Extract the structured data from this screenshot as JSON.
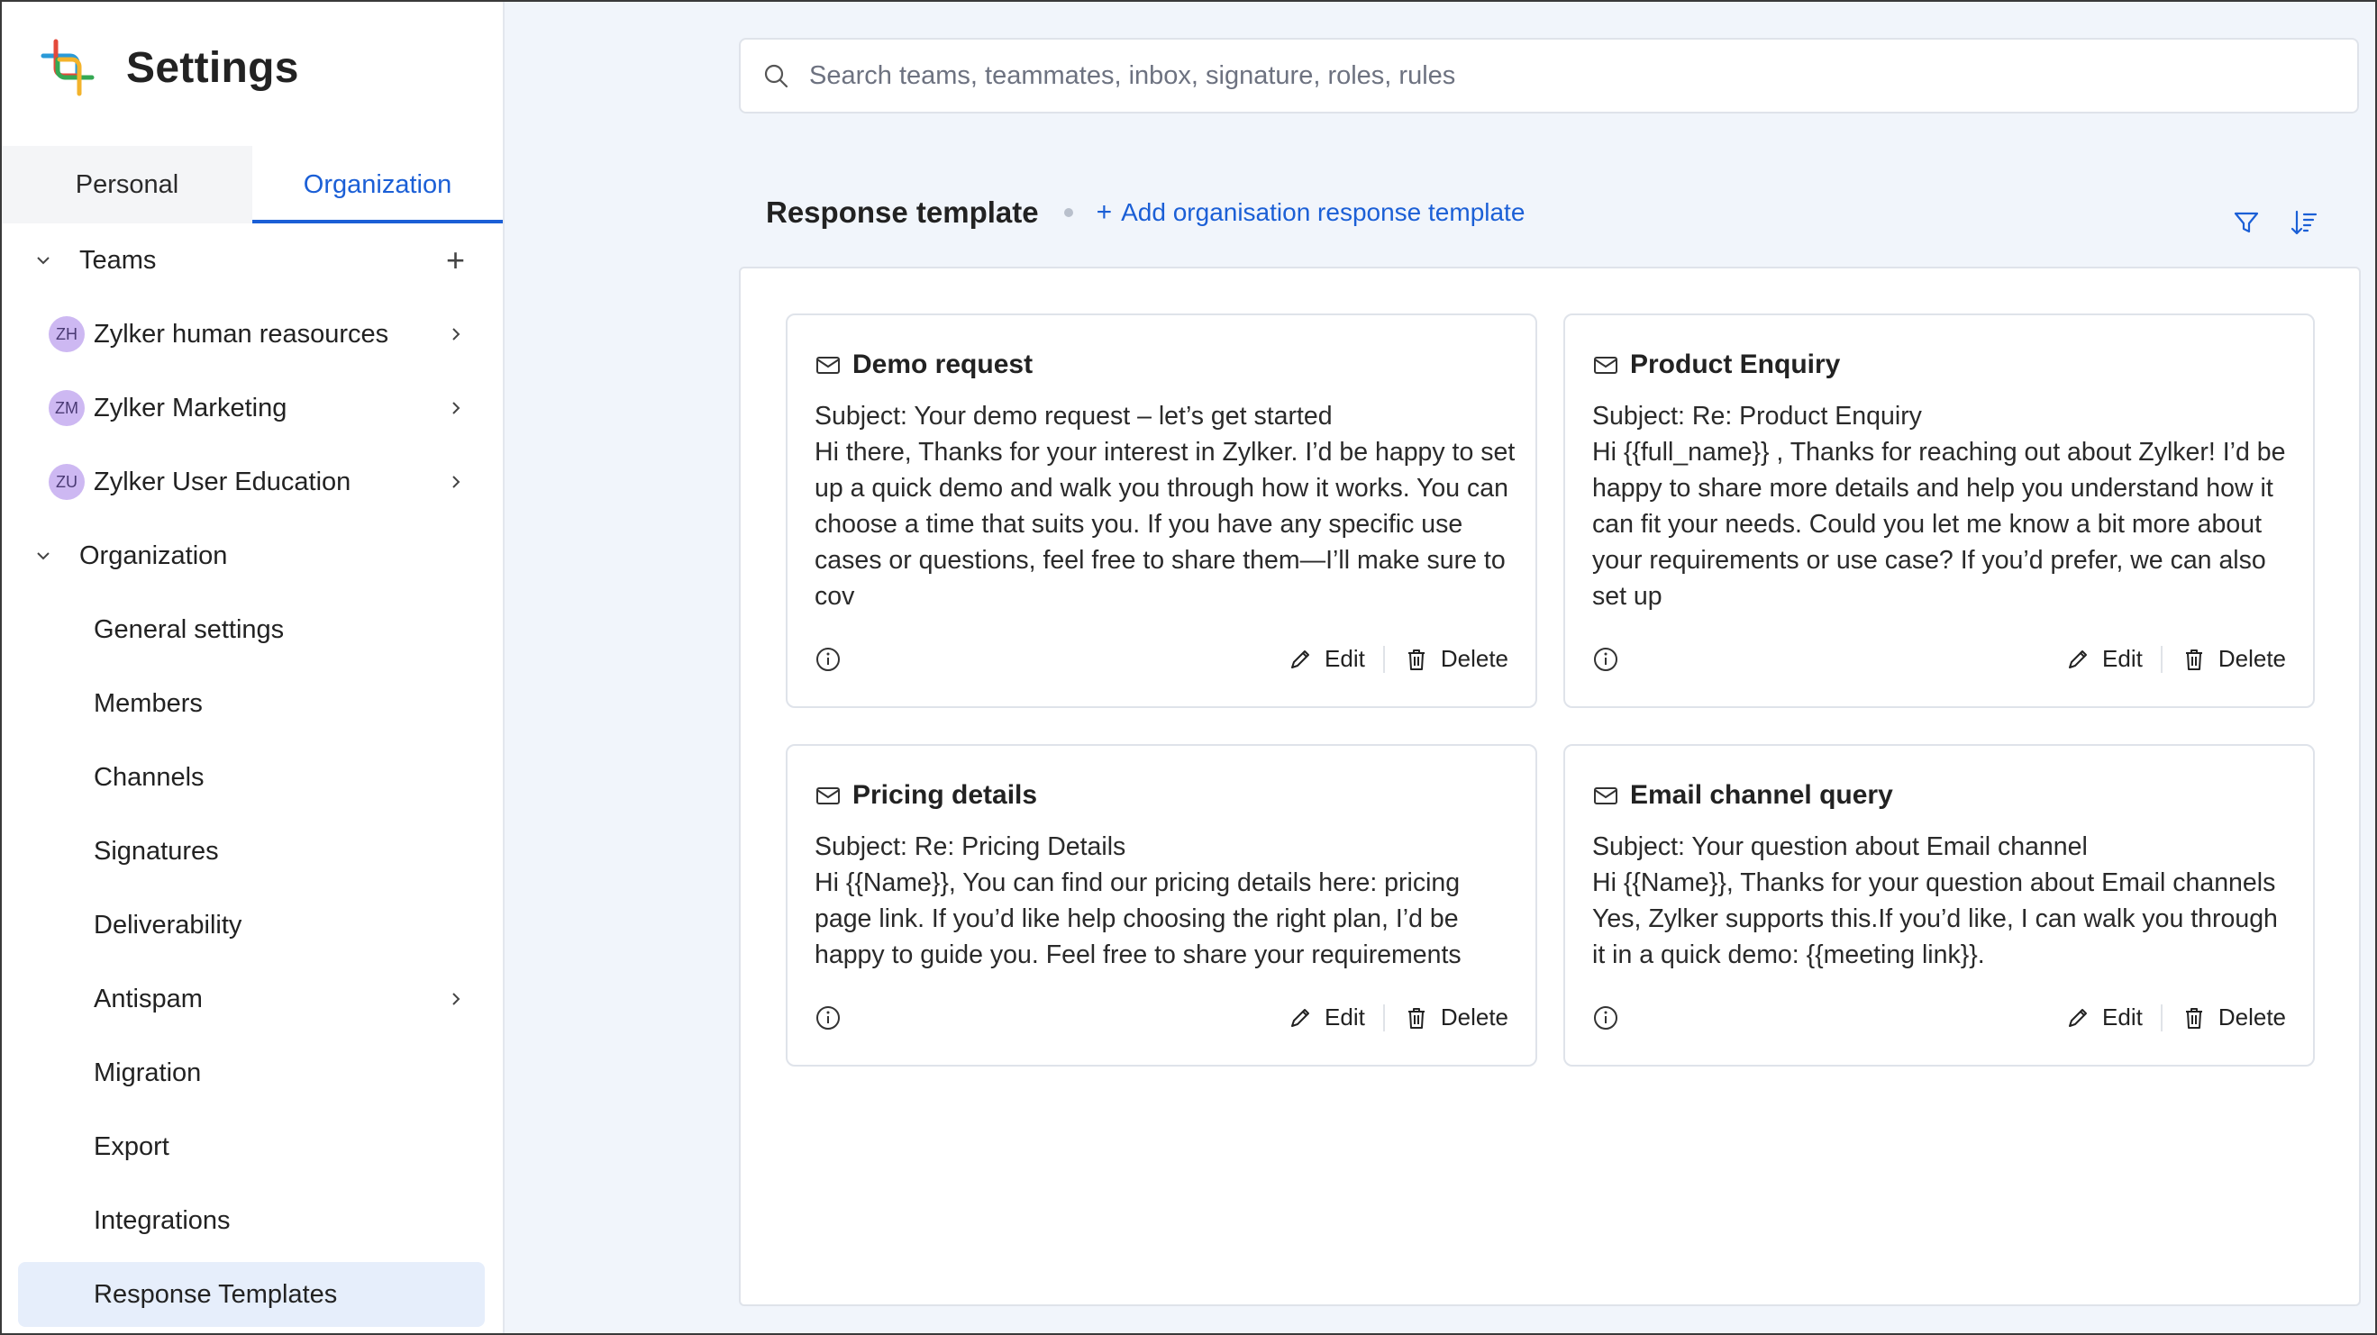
{
  "app": {
    "title": "Settings"
  },
  "tabs": [
    {
      "label": "Personal",
      "active": false
    },
    {
      "label": "Organization",
      "active": true
    }
  ],
  "sidebar": {
    "teams_section": {
      "label": "Teams"
    },
    "teams": [
      {
        "initials": "ZH",
        "label": "Zylker human reasources"
      },
      {
        "initials": "ZM",
        "label": "Zylker Marketing"
      },
      {
        "initials": "ZU",
        "label": "Zylker User Education"
      }
    ],
    "org_section": {
      "label": "Organization"
    },
    "items": [
      {
        "label": "General settings"
      },
      {
        "label": "Members"
      },
      {
        "label": "Channels"
      },
      {
        "label": "Signatures"
      },
      {
        "label": "Deliverability"
      },
      {
        "label": "Antispam"
      },
      {
        "label": "Migration"
      },
      {
        "label": "Export"
      },
      {
        "label": "Integrations"
      },
      {
        "label": "Response Templates"
      }
    ]
  },
  "search": {
    "placeholder": "Search teams, teammates, inbox, signature, roles, rules"
  },
  "main": {
    "title": "Response template",
    "add_label": "Add organisation response template",
    "add_icon": "+",
    "cards": [
      {
        "title": "Demo request",
        "subject": "Subject: Your demo request – let’s get started",
        "body": "Hi there, Thanks for your interest in Zylker. I’d be happy to set up a quick demo and walk you through how it works. You can choose a time that suits you. If you have any specific use cases or questions, feel free to share them—I’ll make sure to cov",
        "edit": "Edit",
        "delete": "Delete"
      },
      {
        "title": "Product Enquiry",
        "subject": "Subject: Re: Product Enquiry",
        "body": "Hi {{full_name}} , Thanks for reaching out about Zylker! I’d be happy to share more details and help you understand how it can fit your needs. Could you let me know a bit more about your requirements or use case? If you’d prefer, we can also set up",
        "edit": "Edit",
        "delete": "Delete"
      },
      {
        "title": "Pricing details",
        "subject": "Subject: Re: Pricing Details",
        "body": "Hi {{Name}}, You can find our pricing details here: pricing page link. If you’d like help choosing the right plan, I’d be happy to guide you. Feel free to share your requirements",
        "edit": "Edit",
        "delete": "Delete"
      },
      {
        "title": "Email channel query",
        "subject": "Subject: Your question about Email channel",
        "body": "Hi {{Name}}, Thanks for your question about Email channels Yes, Zylker supports this.If you’d like, I can walk you through it in a quick demo: {{meeting link}}.",
        "edit": "Edit",
        "delete": "Delete"
      }
    ]
  },
  "colors": {
    "accent": "#1b5fd6",
    "selected_bg": "#e6eefb",
    "avatar_bg": "#cdb8f2"
  }
}
